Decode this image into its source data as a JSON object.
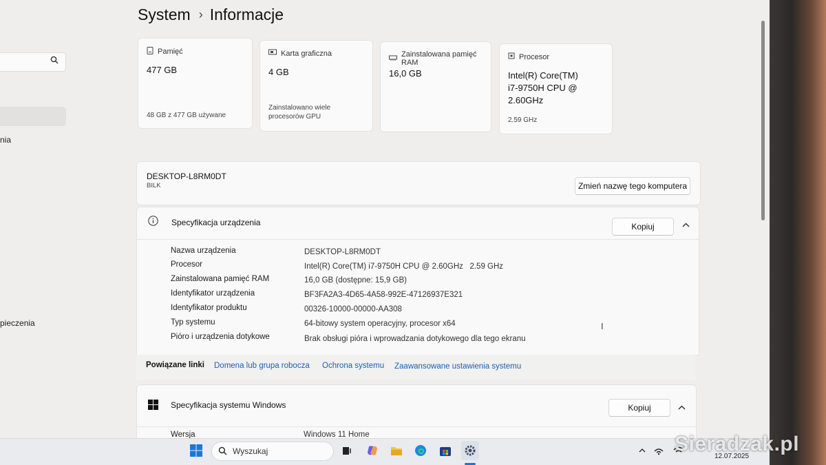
{
  "breadcrumb": {
    "parent": "System",
    "separator": "›",
    "current": "Informacje"
  },
  "sidebar": {
    "items": [
      {
        "label": "nia"
      },
      {
        "label": "pieczenia"
      }
    ]
  },
  "cards": {
    "storage": {
      "title": "Pamięć",
      "value": "477 GB",
      "sub": "48 GB z 477 GB używane"
    },
    "gpu": {
      "title": "Karta graficzna",
      "value": "4 GB",
      "sub1": "Zainstalowano wiele",
      "sub2": "procesorów GPU"
    },
    "ram": {
      "title": "Zainstalowana pamięć RAM",
      "value": "16,0 GB"
    },
    "cpu": {
      "title": "Procesor",
      "value1": "Intel(R) Core(TM)",
      "value2": "i7-9750H CPU @",
      "value3": "2.60GHz",
      "sub": "2.59 GHz"
    }
  },
  "device": {
    "name": "DESKTOP-L8RM0DT",
    "model": "BILK",
    "rename_button": "Zmień nazwę tego komputera"
  },
  "device_spec": {
    "title": "Specyfikacja urządzenia",
    "copy_button": "Kopiuj",
    "rows": [
      {
        "label": "Nazwa urządzenia",
        "value": "DESKTOP-L8RM0DT"
      },
      {
        "label": "Procesor",
        "value": "Intel(R) Core(TM) i7-9750H CPU @ 2.60GHz   2.59 GHz"
      },
      {
        "label": "Zainstalowana pamięć RAM",
        "value": "16,0 GB (dostępne: 15,9 GB)"
      },
      {
        "label": "Identyfikator urządzenia",
        "value": "BF3FA2A3-4D65-4A58-992E-47126937E321"
      },
      {
        "label": "Identyfikator produktu",
        "value": "00326-10000-00000-AA308"
      },
      {
        "label": "Typ systemu",
        "value": "64-bitowy system operacyjny, procesor x64"
      },
      {
        "label": "Pióro i urządzenia dotykowe",
        "value": "Brak obsługi pióra i wprowadzania dotykowego dla tego ekranu"
      }
    ]
  },
  "related_links": {
    "title": "Powiązane linki",
    "links": [
      "Domena lub grupa robocza",
      "Ochrona systemu",
      "Zaawansowane ustawienia systemu"
    ]
  },
  "windows_spec": {
    "title": "Specyfikacja systemu Windows",
    "copy_button": "Kopiuj",
    "rows": [
      {
        "label": "Wersja",
        "value": "Windows 11 Home"
      }
    ]
  },
  "taskbar": {
    "search_label": "Wyszukaj",
    "date": "12.07.2025"
  },
  "watermark": "Sieradzak.pl"
}
